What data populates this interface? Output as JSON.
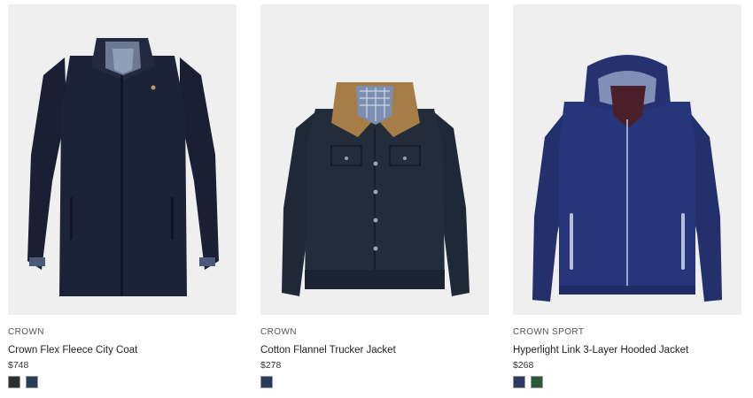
{
  "products": [
    {
      "brand": "CROWN",
      "name": "Crown Flex Fleece City Coat",
      "price": "$748",
      "swatches": [
        {
          "color": "#2b302c",
          "label": "dark-olive"
        },
        {
          "color": "#2c3a5c",
          "label": "navy"
        }
      ]
    },
    {
      "brand": "CROWN",
      "name": "Cotton Flannel Trucker Jacket",
      "price": "$278",
      "swatches": [
        {
          "color": "#2d3a5c",
          "label": "navy"
        }
      ]
    },
    {
      "brand": "CROWN SPORT",
      "name": "Hyperlight Link 3-Layer Hooded Jacket",
      "price": "$268",
      "swatches": [
        {
          "color": "#2d3a62",
          "label": "navy"
        },
        {
          "color": "#2a5a3a",
          "label": "green"
        }
      ]
    }
  ]
}
